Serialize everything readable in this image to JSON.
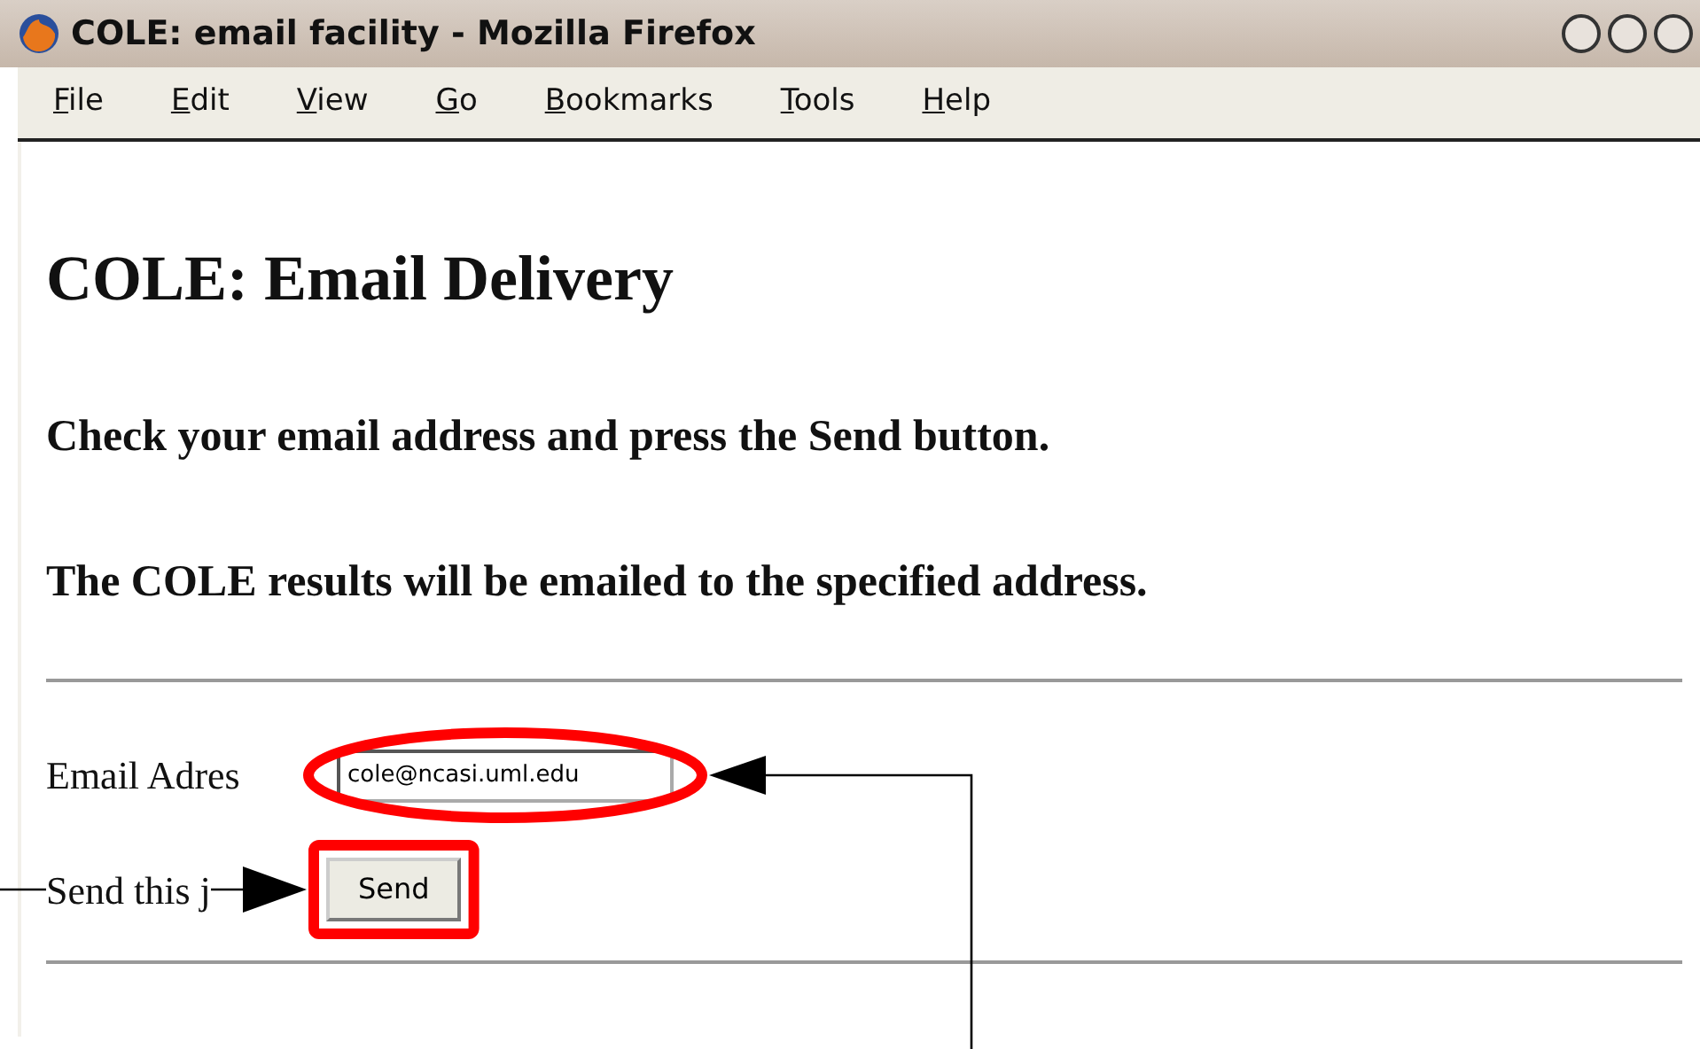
{
  "window": {
    "title": "COLE: email facility - Mozilla Firefox"
  },
  "menu": [
    "File",
    "Edit",
    "View",
    "Go",
    "Bookmarks",
    "Tools",
    "Help"
  ],
  "page": {
    "heading": "COLE: Email Delivery",
    "instructions": [
      "Check your email address and press the Send button.",
      "The COLE results will be emailed to the specified address."
    ],
    "email_label": "Email Adres",
    "email_value": "cole@ncasi.uml.edu",
    "send_label": "Send this j",
    "send_button": "Send"
  }
}
